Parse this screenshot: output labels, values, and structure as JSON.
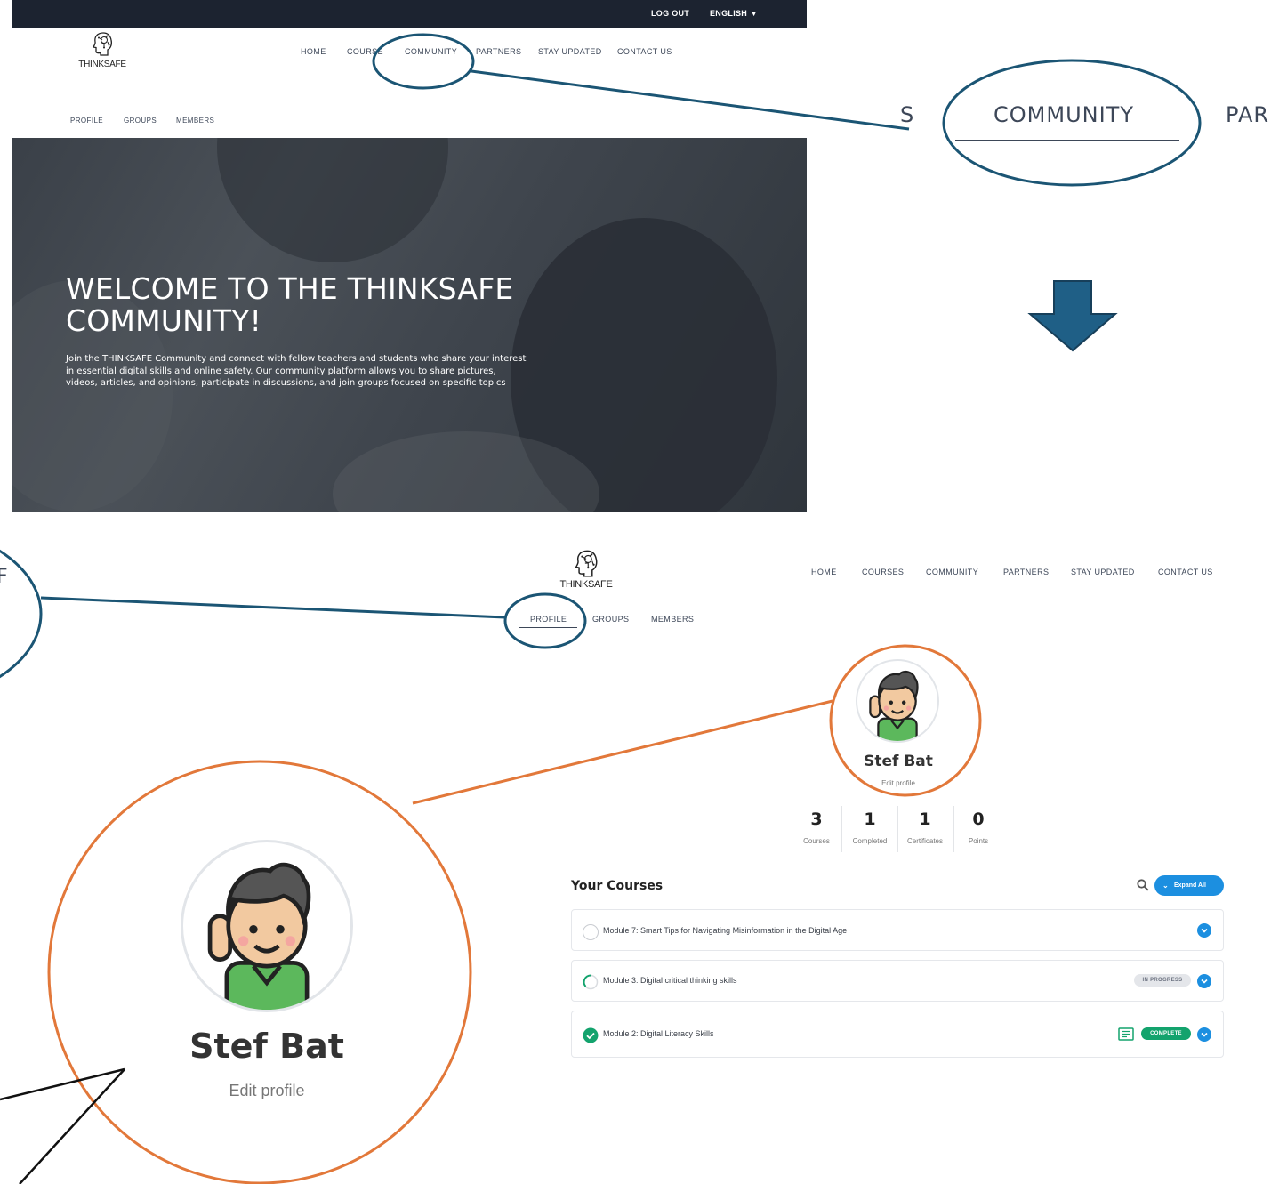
{
  "topbar": {
    "logout": "LOG OUT",
    "language": "ENGLISH"
  },
  "brand": {
    "name": "THINKSAFE"
  },
  "main_nav": {
    "items": [
      "HOME",
      "COURSES",
      "COMMUNITY",
      "PARTNERS",
      "STAY UPDATED",
      "CONTACT US"
    ],
    "top_visible": [
      "HOME",
      "COURSE",
      "COMMUNITY",
      "PARTNERS",
      "STAY UPDATED",
      "CONTACT US"
    ],
    "active": "COMMUNITY"
  },
  "sub_nav": {
    "items": [
      "PROFILE",
      "GROUPS",
      "MEMBERS"
    ],
    "active": "PROFILE"
  },
  "hero": {
    "title": "WELCOME TO THE THINKSAFE COMMUNITY!",
    "text": "Join the THINKSAFE Community and connect with fellow teachers and students who share your interest in essential digital skills and online safety. Our community platform allows you to share pictures, videos, articles, and opinions, participate in discussions, and join groups focused on specific topics"
  },
  "zoom": {
    "left_fragment": "S",
    "label": "COMMUNITY",
    "right_fragment": "PAR",
    "side_fragment": "F"
  },
  "profile": {
    "name": "Stef Bat",
    "edit": "Edit profile",
    "avatar_icon": "boy-waving-avatar",
    "stats": [
      {
        "value": "3",
        "label": "Courses"
      },
      {
        "value": "1",
        "label": "Completed"
      },
      {
        "value": "1",
        "label": "Certificates"
      },
      {
        "value": "0",
        "label": "Points"
      }
    ]
  },
  "courses": {
    "title": "Your Courses",
    "expand_label": "Expand All",
    "items": [
      {
        "title": "Module 7: Smart Tips for Navigating Misinformation in the Digital Age",
        "status": "not-started",
        "badge": ""
      },
      {
        "title": "Module 3: Digital critical thinking skills",
        "status": "in-progress",
        "badge": "IN PROGRESS"
      },
      {
        "title": "Module 2: Digital Literacy Skills",
        "status": "complete",
        "badge": "COMPLETE"
      }
    ]
  },
  "colors": {
    "topbar": "#1c2330",
    "annotation_blue": "#1b5574",
    "annotation_orange": "#e2783a",
    "arrow_blue": "#1f5f86",
    "accent": "#1c8fe0",
    "complete": "#13a36d"
  }
}
